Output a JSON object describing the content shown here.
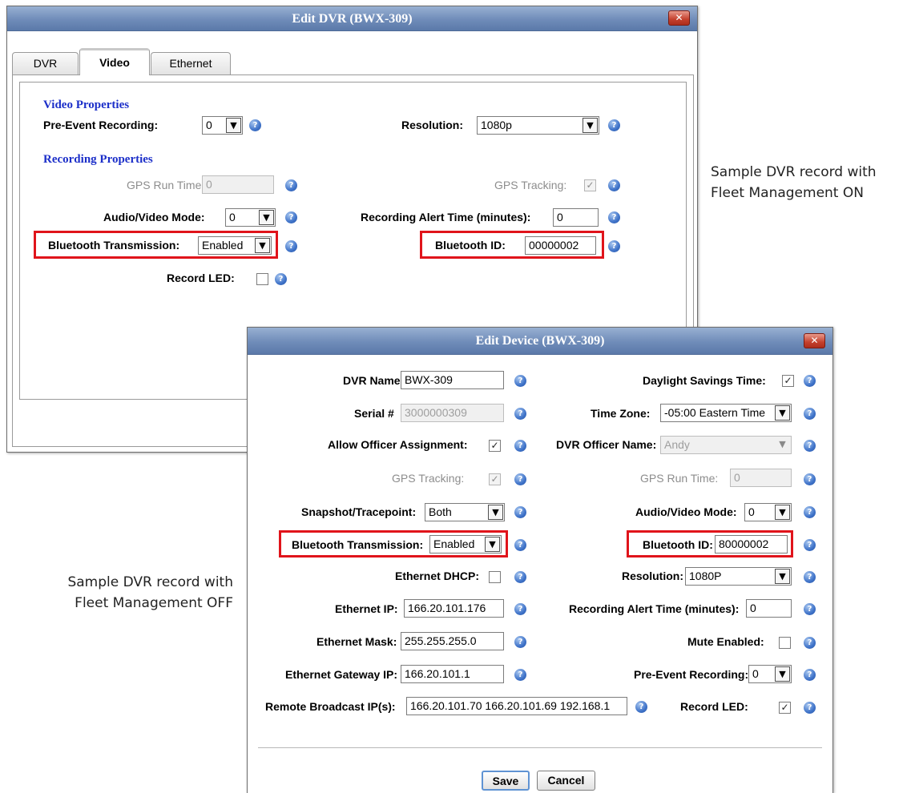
{
  "captions": {
    "on_line1": "Sample DVR record with",
    "on_line2": "Fleet Management ON",
    "off_line1": "Sample DVR record with",
    "off_line2": "Fleet Management OFF"
  },
  "dvr_dialog": {
    "title": "Edit DVR (BWX-309)",
    "close_icon": "close-icon",
    "tabs": [
      {
        "label": "DVR",
        "active": false
      },
      {
        "label": "Video",
        "active": true
      },
      {
        "label": "Ethernet",
        "active": false
      }
    ],
    "video_properties_heading": "Video Properties",
    "recording_properties_heading": "Recording Properties",
    "pre_event_recording": {
      "label": "Pre-Event Recording:",
      "value": "0"
    },
    "resolution": {
      "label": "Resolution:",
      "value": "1080p"
    },
    "gps_run_time": {
      "label": "GPS Run Time:",
      "value": "0"
    },
    "gps_tracking": {
      "label": "GPS Tracking:",
      "checked": true
    },
    "audio_video_mode": {
      "label": "Audio/Video Mode:",
      "value": "0"
    },
    "recording_alert_time": {
      "label": "Recording Alert Time (minutes):",
      "value": "0"
    },
    "bluetooth_transmission": {
      "label": "Bluetooth Transmission:",
      "value": "Enabled"
    },
    "bluetooth_id": {
      "label": "Bluetooth ID:",
      "value": "00000002"
    },
    "record_led": {
      "label": "Record LED:",
      "checked": false
    }
  },
  "device_dialog": {
    "title": "Edit Device (BWX-309)",
    "close_icon": "close-icon",
    "dvr_name": {
      "label": "DVR Name",
      "value": "BWX-309"
    },
    "serial": {
      "label": "Serial #",
      "value": "3000000309"
    },
    "allow_officer_assignment": {
      "label": "Allow Officer Assignment:",
      "checked": true
    },
    "gps_tracking": {
      "label": "GPS Tracking:",
      "checked": true
    },
    "snapshot_tracepoint": {
      "label": "Snapshot/Tracepoint:",
      "value": "Both"
    },
    "bluetooth_transmission": {
      "label": "Bluetooth Transmission:",
      "value": "Enabled"
    },
    "ethernet_dhcp": {
      "label": "Ethernet DHCP:",
      "checked": false
    },
    "ethernet_ip": {
      "label": "Ethernet IP:",
      "value": "166.20.101.176"
    },
    "ethernet_mask": {
      "label": "Ethernet Mask:",
      "value": "255.255.255.0"
    },
    "ethernet_gateway_ip": {
      "label": "Ethernet Gateway IP:",
      "value": "166.20.101.1"
    },
    "remote_broadcast_ips": {
      "label": "Remote Broadcast IP(s):",
      "value": "166.20.101.70 166.20.101.69 192.168.1"
    },
    "daylight_savings_time": {
      "label": "Daylight Savings Time:",
      "checked": true
    },
    "time_zone": {
      "label": "Time Zone:",
      "value": "-05:00 Eastern Time"
    },
    "dvr_officer_name": {
      "label": "DVR Officer Name:",
      "value": "Andy"
    },
    "gps_run_time": {
      "label": "GPS Run Time:",
      "value": "0"
    },
    "audio_video_mode": {
      "label": "Audio/Video Mode:",
      "value": "0"
    },
    "bluetooth_id": {
      "label": "Bluetooth ID:",
      "value": "80000002"
    },
    "resolution": {
      "label": "Resolution:",
      "value": "1080P"
    },
    "recording_alert_time": {
      "label": "Recording Alert Time (minutes):",
      "value": "0"
    },
    "mute_enabled": {
      "label": "Mute Enabled:",
      "checked": false
    },
    "pre_event_recording": {
      "label": "Pre-Event Recording:",
      "value": "0"
    },
    "record_led": {
      "label": "Record LED:",
      "checked": true
    },
    "buttons": {
      "save": "Save",
      "cancel": "Cancel"
    }
  },
  "glyphs": {
    "close": "✕",
    "check": "✓",
    "dropdown": "▼",
    "help": "?"
  },
  "colors": {
    "highlight": "#e0141b",
    "section_heading": "#1c2fc9",
    "titlebar": "#6f8cb9"
  }
}
